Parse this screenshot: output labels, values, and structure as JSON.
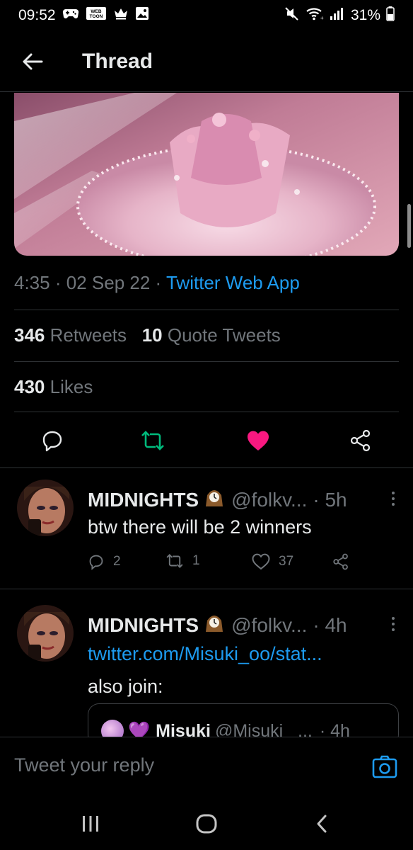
{
  "status_bar": {
    "time": "09:52",
    "left_icons": [
      "game-controller-icon",
      "webtoon-icon",
      "crown-icon",
      "gallery-icon"
    ],
    "webtoon_text": "WEB TOON",
    "battery": "31%",
    "right_icons": [
      "mute-icon",
      "wifi-icon",
      "signal-icon",
      "battery-icon"
    ]
  },
  "header": {
    "title": "Thread",
    "back_icon": "arrow-left-icon"
  },
  "tweet": {
    "time": "4:35",
    "date": "02 Sep 22",
    "separator": "·",
    "source": "Twitter Web App",
    "retweets_count": "346",
    "retweets_label": "Retweets",
    "quotes_count": "10",
    "quotes_label": "Quote Tweets",
    "likes_count": "430",
    "likes_label": "Likes",
    "actions": [
      "reply-icon",
      "retweet-icon",
      "like-icon",
      "share-icon"
    ],
    "colors": {
      "retweet": "#00ba7c",
      "like": "#f91880",
      "link": "#1d9bf0"
    }
  },
  "replies": [
    {
      "name": "MIDNIGHTS",
      "handle": "@folkv...",
      "time": "· 5h",
      "text": "btw there will be 2 winners",
      "reply_count": "2",
      "retweet_count": "1",
      "like_count": "37"
    },
    {
      "name": "MIDNIGHTS",
      "handle": "@folkv...",
      "time": "· 4h",
      "link": "twitter.com/Misuki_oo/stat...",
      "text": "also join:",
      "quote": {
        "name": "Misuki",
        "handle": "@Misuki_ ...",
        "time": "· 4h",
        "emoji": "💜"
      }
    }
  ],
  "composer": {
    "placeholder": "Tweet your reply",
    "camera_icon": "camera-icon"
  },
  "nav": [
    "recent-apps-icon",
    "home-icon",
    "back-icon"
  ]
}
